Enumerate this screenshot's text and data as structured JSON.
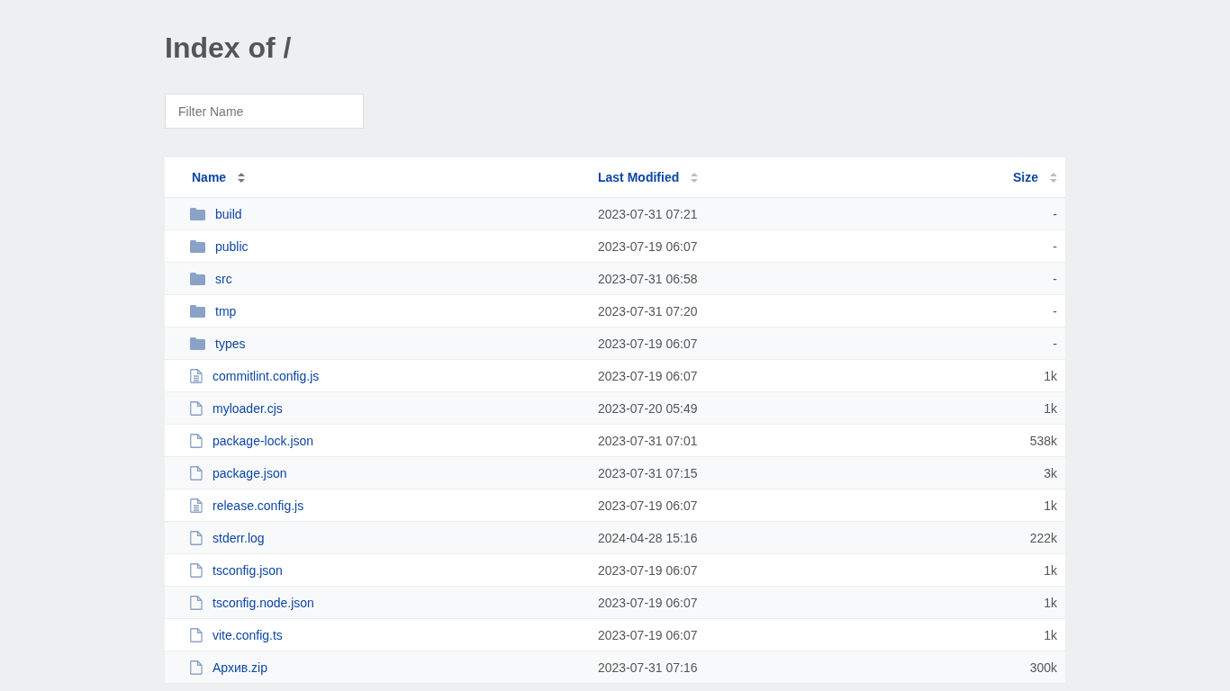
{
  "title": "Index of /",
  "filter": {
    "placeholder": "Filter Name"
  },
  "columns": [
    {
      "label": "Name",
      "sorted": true
    },
    {
      "label": "Last Modified",
      "sorted": false
    },
    {
      "label": "Size",
      "sorted": false
    }
  ],
  "rows": [
    {
      "kind": "folder",
      "name": "build",
      "modified": "2023-07-31 07:21",
      "size": "-"
    },
    {
      "kind": "folder",
      "name": "public",
      "modified": "2023-07-19 06:07",
      "size": "-"
    },
    {
      "kind": "folder",
      "name": "src",
      "modified": "2023-07-31 06:58",
      "size": "-"
    },
    {
      "kind": "folder",
      "name": "tmp",
      "modified": "2023-07-31 07:20",
      "size": "-"
    },
    {
      "kind": "folder",
      "name": "types",
      "modified": "2023-07-19 06:07",
      "size": "-"
    },
    {
      "kind": "text",
      "name": "commitlint.config.js",
      "modified": "2023-07-19 06:07",
      "size": "1k"
    },
    {
      "kind": "file",
      "name": "myloader.cjs",
      "modified": "2023-07-20 05:49",
      "size": "1k"
    },
    {
      "kind": "file",
      "name": "package-lock.json",
      "modified": "2023-07-31 07:01",
      "size": "538k"
    },
    {
      "kind": "file",
      "name": "package.json",
      "modified": "2023-07-31 07:15",
      "size": "3k"
    },
    {
      "kind": "text",
      "name": "release.config.js",
      "modified": "2023-07-19 06:07",
      "size": "1k"
    },
    {
      "kind": "file",
      "name": "stderr.log",
      "modified": "2024-04-28 15:16",
      "size": "222k"
    },
    {
      "kind": "file",
      "name": "tsconfig.json",
      "modified": "2023-07-19 06:07",
      "size": "1k"
    },
    {
      "kind": "file",
      "name": "tsconfig.node.json",
      "modified": "2023-07-19 06:07",
      "size": "1k"
    },
    {
      "kind": "file",
      "name": "vite.config.ts",
      "modified": "2023-07-19 06:07",
      "size": "1k"
    },
    {
      "kind": "file",
      "name": "Архив.zip",
      "modified": "2023-07-31 07:16",
      "size": "300k"
    }
  ]
}
